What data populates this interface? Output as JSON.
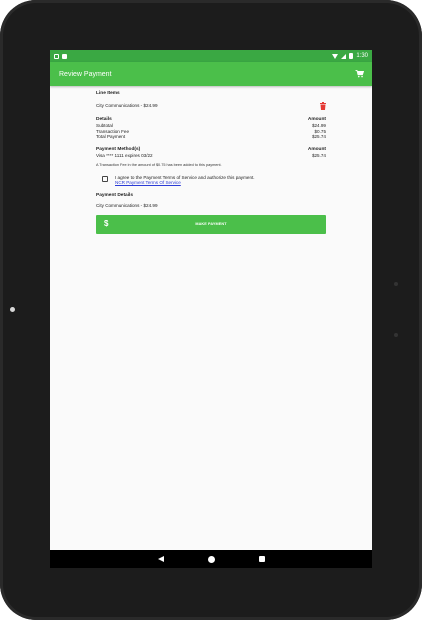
{
  "status_bar": {
    "time": "1:30"
  },
  "app_bar": {
    "title": "Review Payment",
    "cart_icon": "cart-icon"
  },
  "line_items": {
    "title": "Line Items",
    "items": [
      {
        "label": "City Communications - $24.99"
      }
    ]
  },
  "details": {
    "title": "Details",
    "amount_header": "Amount",
    "rows": [
      {
        "label": "Subtotal",
        "value": "$24.99"
      },
      {
        "label": "Transaction Fee",
        "value": "$0.75"
      },
      {
        "label": "Total Payment",
        "value": "$25.74"
      }
    ]
  },
  "payment_method": {
    "title": "Payment Method(s)",
    "amount_header": "Amount",
    "card": "Visa **** 1111 expires 03/22",
    "amount": "$25.74",
    "fee_note": "A Transaction Fee in the amount of $0.75 has been added to this payment."
  },
  "agreement": {
    "text": "I agree to the Payment Terms of Service and authorize this payment.",
    "link": "NCR Payment Terms Of Service",
    "checked": false
  },
  "payment_details": {
    "title": "Payment Details",
    "line": "City Communications - $24.99"
  },
  "make_payment": {
    "label": "MAKE PAYMENT",
    "icon": "$"
  },
  "colors": {
    "primary": "#4bbf4a",
    "status_bar": "#3aa843",
    "delete": "#e53935",
    "link": "#2b3bd6"
  }
}
